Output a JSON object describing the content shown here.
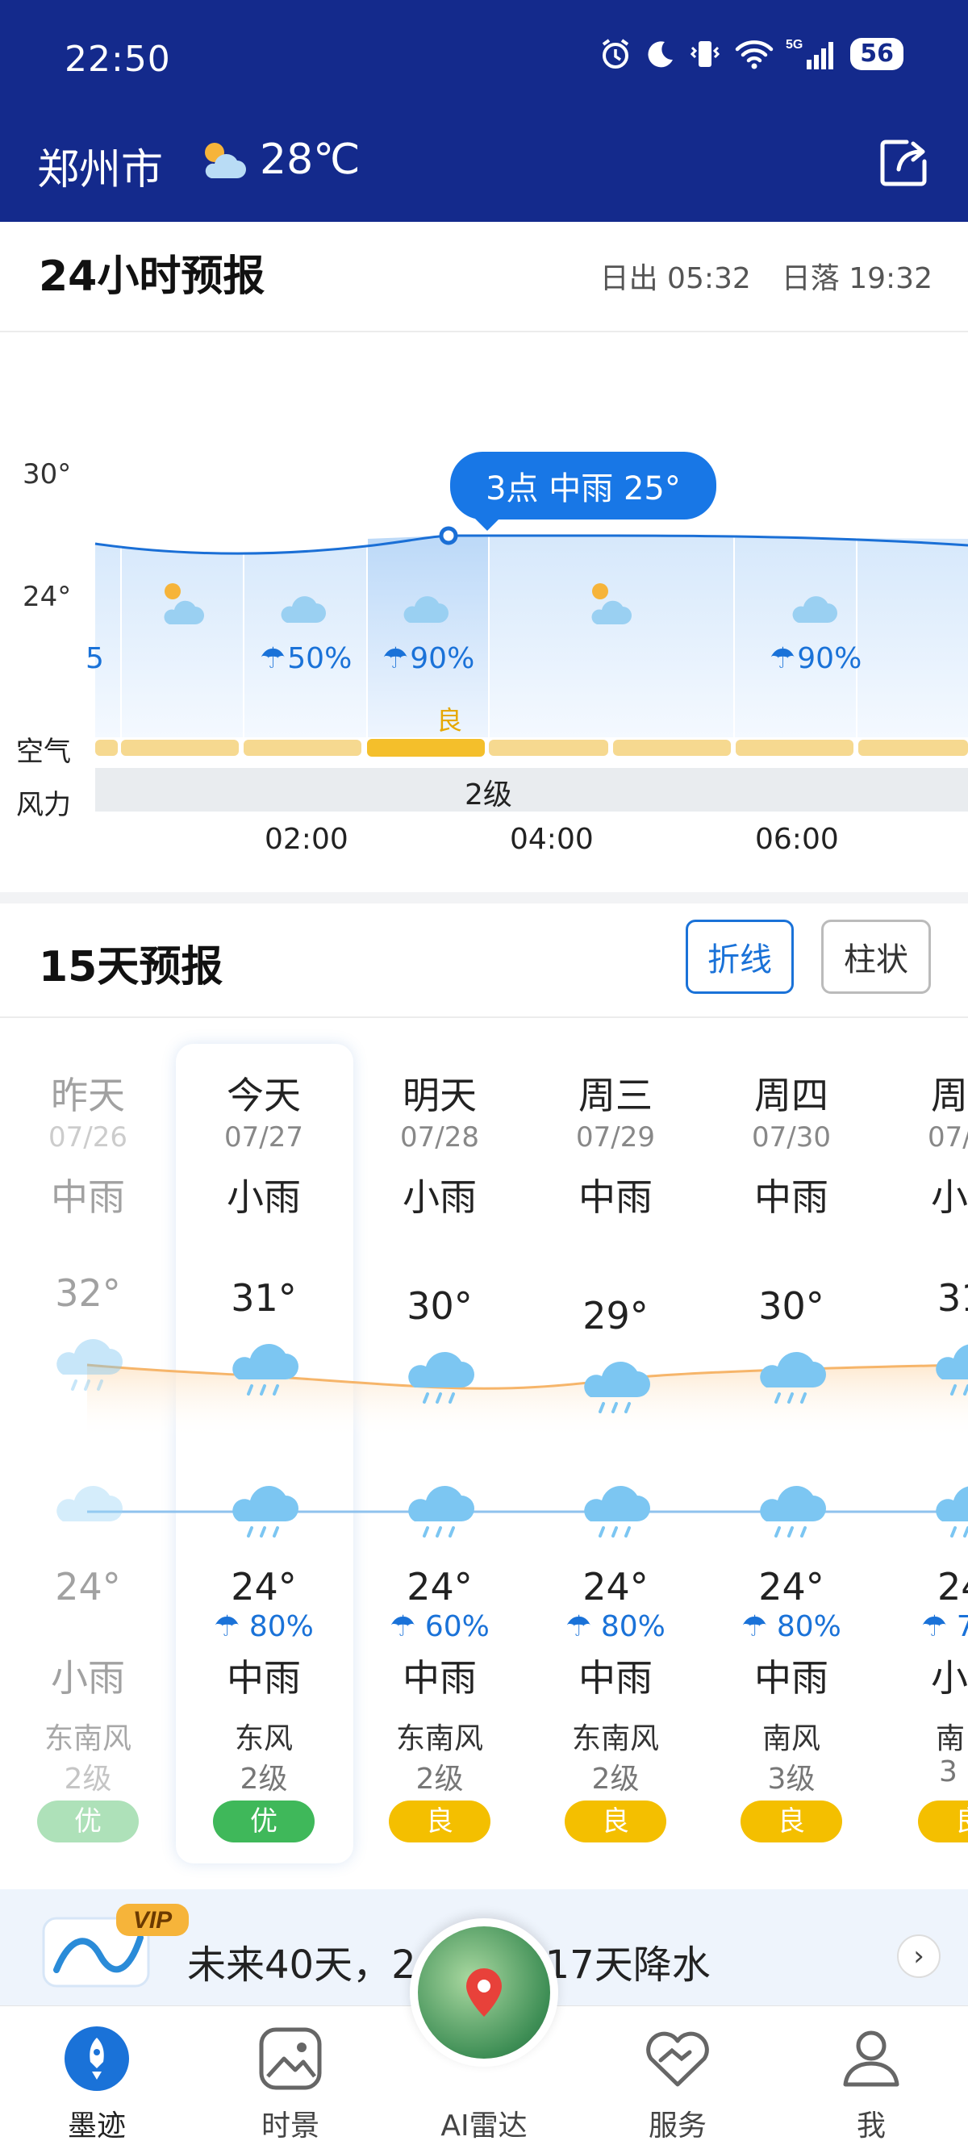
{
  "status": {
    "time": "22:50",
    "battery": "56",
    "network": "5G"
  },
  "header": {
    "city": "郑州市",
    "temperature": "28℃"
  },
  "hourly": {
    "title": "24小时预报",
    "sunrise": "日出 05:32",
    "sunset": "日落 19:32",
    "axis_top": "30°",
    "axis_mid": "24°",
    "air_label": "空气",
    "wind_label": "风力",
    "wind_value": "2级",
    "air_good": "良",
    "tooltip": "3点 中雨 25°",
    "precip": [
      "5",
      "50%",
      "90%",
      "90%"
    ],
    "hours": [
      "02:00",
      "04:00",
      "06:00"
    ]
  },
  "daily": {
    "title": "15天预报",
    "toggle_line": "折线",
    "toggle_bar": "柱状",
    "days": [
      {
        "name": "昨天",
        "date": "07/26",
        "day_weather": "中雨",
        "high": "32°",
        "low": "24°",
        "precip": "",
        "night_weather": "小雨",
        "wind": "东南风",
        "level": "2级",
        "aqi": "优"
      },
      {
        "name": "今天",
        "date": "07/27",
        "day_weather": "小雨",
        "high": "31°",
        "low": "24°",
        "precip": "80%",
        "night_weather": "中雨",
        "wind": "东风",
        "level": "2级",
        "aqi": "优"
      },
      {
        "name": "明天",
        "date": "07/28",
        "day_weather": "小雨",
        "high": "30°",
        "low": "24°",
        "precip": "60%",
        "night_weather": "中雨",
        "wind": "东南风",
        "level": "2级",
        "aqi": "良"
      },
      {
        "name": "周三",
        "date": "07/29",
        "day_weather": "中雨",
        "high": "29°",
        "low": "24°",
        "precip": "80%",
        "night_weather": "中雨",
        "wind": "东南风",
        "level": "2级",
        "aqi": "良"
      },
      {
        "name": "周四",
        "date": "07/30",
        "day_weather": "中雨",
        "high": "30°",
        "low": "24°",
        "precip": "80%",
        "night_weather": "中雨",
        "wind": "南风",
        "level": "3级",
        "aqi": "良"
      },
      {
        "name": "周",
        "date": "07/",
        "day_weather": "小",
        "high": "31",
        "low": "24",
        "precip": "7",
        "night_weather": "小",
        "wind": "南",
        "level": "3",
        "aqi": "良"
      }
    ]
  },
  "vip": {
    "badge": "VIP",
    "text_start": "未来40天，2",
    "text_end": "17天降水"
  },
  "nav": {
    "items": [
      "墨迹",
      "时景",
      "AI雷达",
      "服务",
      "我"
    ]
  },
  "colors": {
    "header_bg": "#142a8c",
    "accent": "#1a72d8",
    "aqi_excellent": "#3fb85a",
    "aqi_good": "#f4bf00"
  }
}
